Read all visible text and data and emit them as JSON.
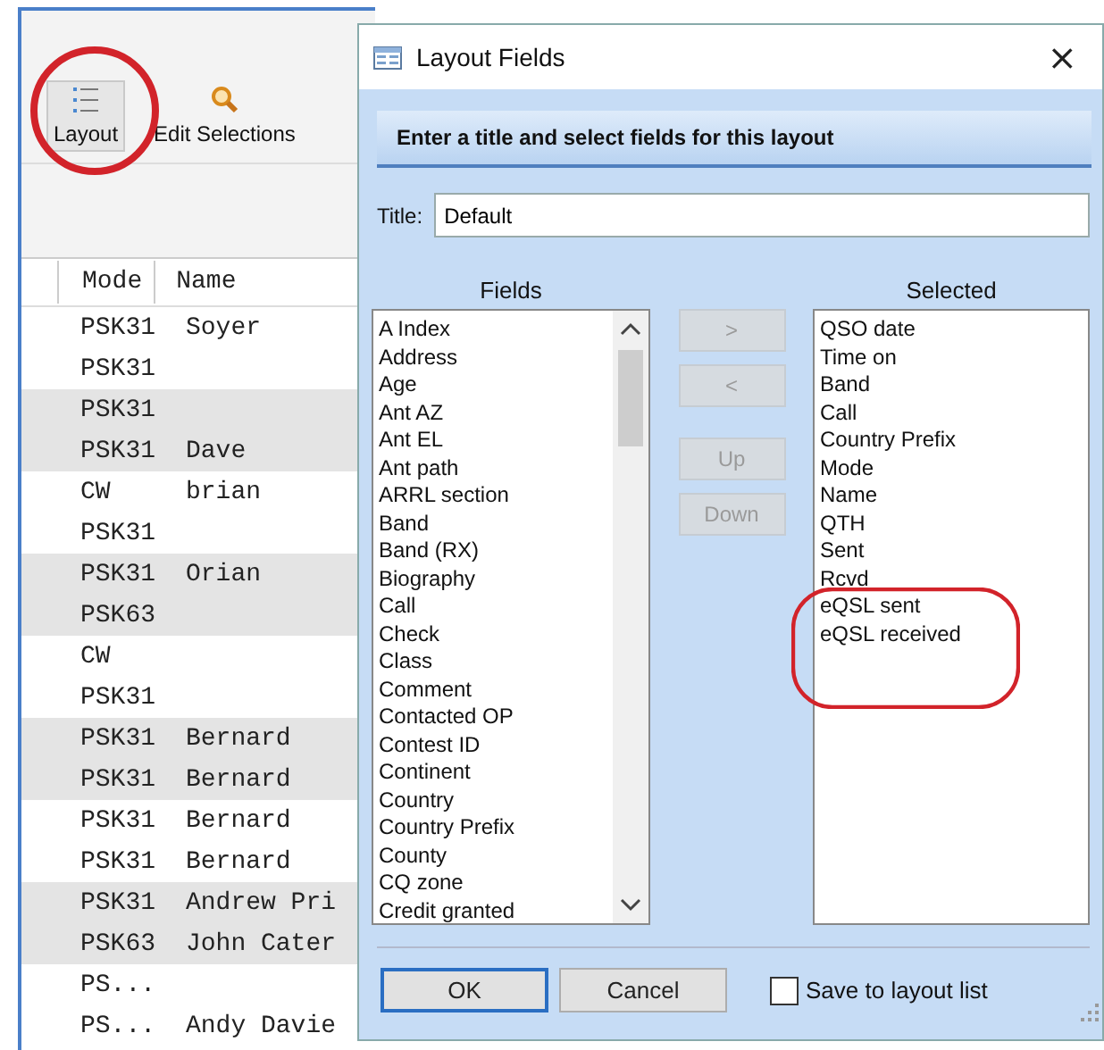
{
  "toolbar": {
    "buttons": [
      {
        "label": "Layout",
        "selected": true
      },
      {
        "label": "Edit Selections",
        "selected": false
      }
    ]
  },
  "log": {
    "columns": [
      "Mode",
      "Name"
    ],
    "rows": [
      {
        "mode": "PSK31",
        "name": "Soyer"
      },
      {
        "mode": "PSK31",
        "name": ""
      },
      {
        "mode": "PSK31",
        "name": ""
      },
      {
        "mode": "PSK31",
        "name": "Dave"
      },
      {
        "mode": "CW",
        "name": "brian"
      },
      {
        "mode": "PSK31",
        "name": ""
      },
      {
        "mode": "PSK31",
        "name": "Orian"
      },
      {
        "mode": "PSK63",
        "name": ""
      },
      {
        "mode": "CW",
        "name": ""
      },
      {
        "mode": "PSK31",
        "name": ""
      },
      {
        "mode": "PSK31",
        "name": "Bernard"
      },
      {
        "mode": "PSK31",
        "name": "Bernard"
      },
      {
        "mode": "PSK31",
        "name": "Bernard"
      },
      {
        "mode": "PSK31",
        "name": "Bernard"
      },
      {
        "mode": "PSK31",
        "name": "Andrew Pri"
      },
      {
        "mode": "PSK63",
        "name": "John Cater"
      },
      {
        "mode": "PS...",
        "name": ""
      },
      {
        "mode": "PS...",
        "name": "Andy Davie"
      }
    ]
  },
  "dialog": {
    "title": "Layout Fields",
    "close": "×",
    "banner": "Enter a title and select fields for this layout",
    "title_field": {
      "label": "Title:",
      "value": "Default"
    },
    "fields": {
      "heading": "Fields",
      "items": [
        "A Index",
        "Address",
        "Age",
        "Ant AZ",
        "Ant EL",
        "Ant path",
        "ARRL section",
        "Band",
        "Band (RX)",
        "Biography",
        "Call",
        "Check",
        "Class",
        "Comment",
        "Contacted OP",
        "Contest ID",
        "Continent",
        "Country",
        "Country Prefix",
        "County",
        "CQ zone",
        "Credit granted"
      ]
    },
    "move_buttons": [
      {
        "label": ">",
        "disabled": true
      },
      {
        "label": "<",
        "disabled": true
      },
      {
        "label": "Up",
        "disabled": true
      },
      {
        "label": "Down",
        "disabled": true
      }
    ],
    "selected": {
      "heading": "Selected",
      "items": [
        "QSO date",
        "Time on",
        "Band",
        "Call",
        "Country Prefix",
        "Mode",
        "Name",
        "QTH",
        "Sent",
        "Rcvd",
        "eQSL sent",
        "eQSL received"
      ]
    },
    "buttons": [
      {
        "label": "OK",
        "default": true
      },
      {
        "label": "Cancel",
        "default": false
      }
    ],
    "save_option": {
      "label": "Save to layout list",
      "checked": false
    }
  }
}
